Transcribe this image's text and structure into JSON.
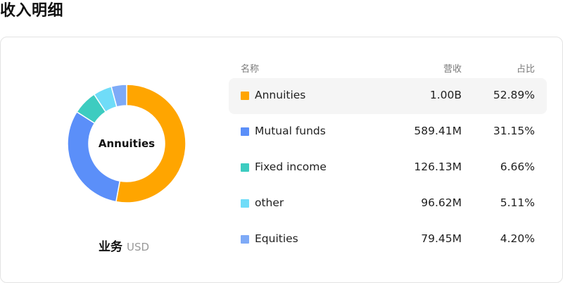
{
  "page": {
    "title": "收入明细"
  },
  "chart": {
    "center_label": "Annuities",
    "footer_title": "业务",
    "footer_currency": "USD"
  },
  "table": {
    "headers": {
      "name": "名称",
      "revenue": "营收",
      "share": "占比"
    },
    "rows": [
      {
        "name": "Annuities",
        "revenue": "1.00B",
        "share": "52.89%",
        "color": "#FFA500"
      },
      {
        "name": "Mutual funds",
        "revenue": "589.41M",
        "share": "31.15%",
        "color": "#5B8FF9"
      },
      {
        "name": "Fixed income",
        "revenue": "126.13M",
        "share": "6.66%",
        "color": "#3DCCC0"
      },
      {
        "name": "other",
        "revenue": "96.62M",
        "share": "5.11%",
        "color": "#6FDCF8"
      },
      {
        "name": "Equities",
        "revenue": "79.45M",
        "share": "4.20%",
        "color": "#7EAAF7"
      }
    ]
  },
  "chart_data": {
    "type": "pie",
    "categories": [
      "Annuities",
      "Mutual funds",
      "Fixed income",
      "other",
      "Equities"
    ],
    "values": [
      52.89,
      31.15,
      6.66,
      5.11,
      4.2
    ],
    "colors": [
      "#FFA500",
      "#5B8FF9",
      "#3DCCC0",
      "#6FDCF8",
      "#7EAAF7"
    ]
  }
}
